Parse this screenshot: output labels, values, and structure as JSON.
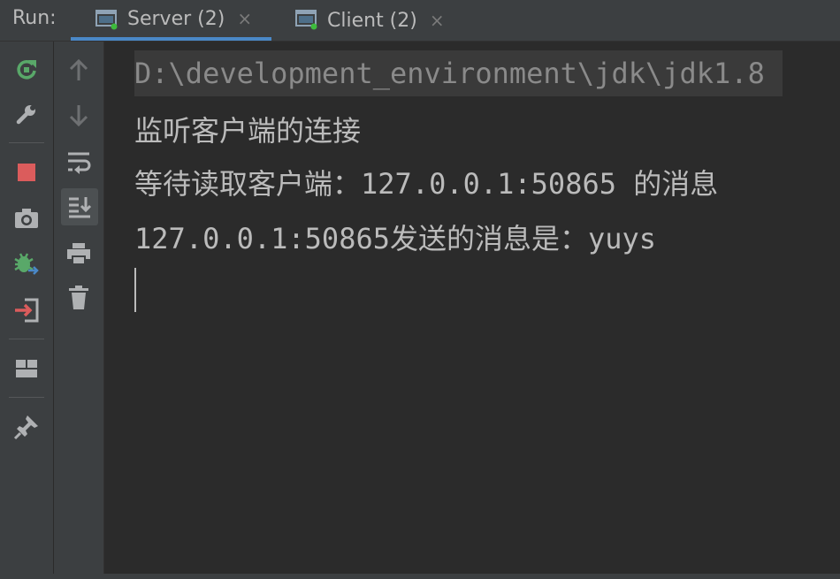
{
  "run_panel": {
    "label": "Run:",
    "tabs": [
      {
        "title": "Server (2)",
        "active": true,
        "icon": "console-window-icon"
      },
      {
        "title": "Client (2)",
        "active": false,
        "icon": "console-window-icon"
      }
    ],
    "close_glyph": "×"
  },
  "toolbar_primary": [
    {
      "icon": "rerun-icon",
      "color": "#59a869"
    },
    {
      "icon": "wrench-icon",
      "color": "#afb1b3"
    },
    {
      "icon": "stop-icon",
      "color": "#db5c5c"
    },
    {
      "icon": "camera-icon",
      "color": "#afb1b3"
    },
    {
      "icon": "debug-bug-icon",
      "color": "#59a869"
    },
    {
      "icon": "exit-icon",
      "color": "#db5c5c"
    },
    {
      "icon": "layout-icon",
      "color": "#afb1b3"
    },
    {
      "icon": "pin-icon",
      "color": "#afb1b3"
    }
  ],
  "toolbar_secondary": [
    {
      "icon": "arrow-up-icon"
    },
    {
      "icon": "arrow-down-icon"
    },
    {
      "icon": "soft-wrap-icon"
    },
    {
      "icon": "scroll-to-end-icon",
      "active": true
    },
    {
      "icon": "print-icon"
    },
    {
      "icon": "trash-icon"
    }
  ],
  "console": {
    "command_line": "D:\\development_environment\\jdk\\jdk1.8",
    "lines": [
      "监听客户端的连接",
      "等待读取客户端：127.0.0.1:50865 的消息",
      "127.0.0.1:50865发送的消息是：yuys"
    ]
  },
  "colors": {
    "panel_bg": "#3c3f41",
    "console_bg": "#2b2b2b",
    "text": "#bbbbbb",
    "active_tab_underline": "#4a88c7",
    "running_dot": "#3dbb3d"
  }
}
